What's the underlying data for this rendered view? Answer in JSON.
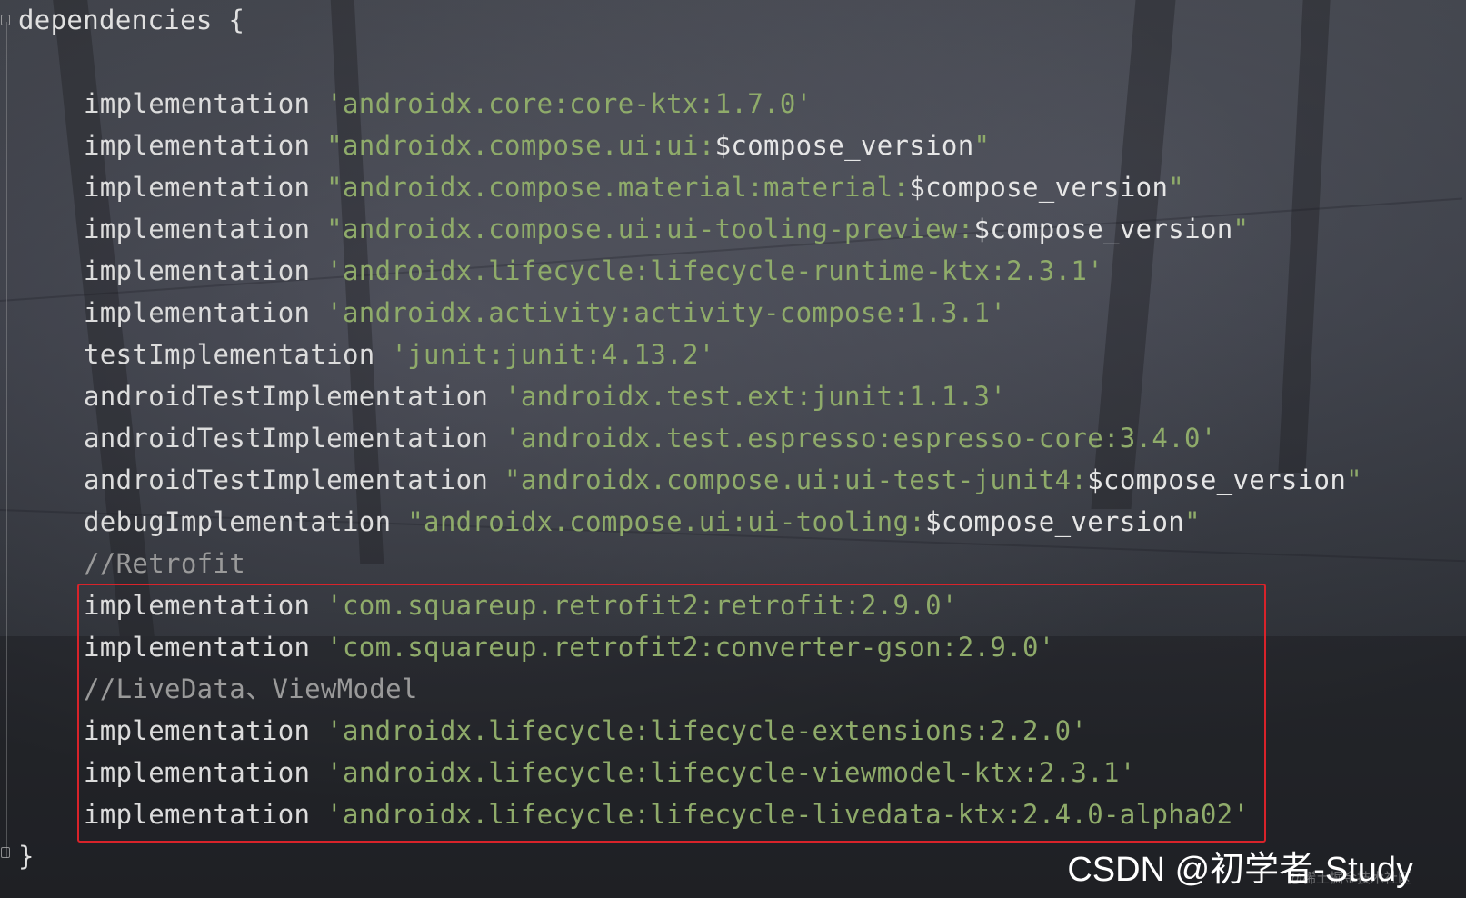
{
  "editor": {
    "colors": {
      "keyword": "#dcdcdc",
      "string": "#8fab6a",
      "comment": "#9a9a9a",
      "highlight_border": "#d8232a"
    },
    "lines": [
      {
        "text": "dependencies {"
      },
      {
        "text": ""
      },
      {
        "keyword": "implementation ",
        "string": "'androidx.core:core-ktx:1.7.0'"
      },
      {
        "keyword": "implementation ",
        "string": "\"androidx.compose.ui:ui:",
        "var": "$compose_version",
        "end": "\""
      },
      {
        "keyword": "implementation ",
        "string": "\"androidx.compose.material:material:",
        "var": "$compose_version",
        "end": "\""
      },
      {
        "keyword": "implementation ",
        "string": "\"androidx.compose.ui:ui-tooling-preview:",
        "var": "$compose_version",
        "end": "\""
      },
      {
        "keyword": "implementation ",
        "string": "'androidx.lifecycle:lifecycle-runtime-ktx:2.3.1'"
      },
      {
        "keyword": "implementation ",
        "string": "'androidx.activity:activity-compose:1.3.1'"
      },
      {
        "keyword": "testImplementation ",
        "string": "'junit:junit:4.13.2'"
      },
      {
        "keyword": "androidTestImplementation ",
        "string": "'androidx.test.ext:junit:1.1.3'"
      },
      {
        "keyword": "androidTestImplementation ",
        "string": "'androidx.test.espresso:espresso-core:3.4.0'"
      },
      {
        "keyword": "androidTestImplementation ",
        "string": "\"androidx.compose.ui:ui-test-junit4:",
        "var": "$compose_version",
        "end": "\""
      },
      {
        "keyword": "debugImplementation ",
        "string": "\"androidx.compose.ui:ui-tooling:",
        "var": "$compose_version",
        "end": "\""
      },
      {
        "comment": "//Retrofit"
      },
      {
        "keyword": "implementation ",
        "string": "'com.squareup.retrofit2:retrofit:2.9.0'"
      },
      {
        "keyword": "implementation ",
        "string": "'com.squareup.retrofit2:converter-gson:2.9.0'"
      },
      {
        "comment": "//LiveData、ViewModel"
      },
      {
        "keyword": "implementation ",
        "string": "'androidx.lifecycle:lifecycle-extensions:2.2.0'"
      },
      {
        "keyword": "implementation ",
        "string": "'androidx.lifecycle:lifecycle-viewmodel-ktx:2.3.1'"
      },
      {
        "keyword": "implementation ",
        "string": "'androidx.lifecycle:lifecycle-livedata-ktx:2.4.0-alpha02'"
      },
      {
        "text": "}"
      }
    ]
  },
  "watermark": {
    "main": "CSDN @初学者-Study",
    "faint": "@稀土掘金技术社区"
  }
}
